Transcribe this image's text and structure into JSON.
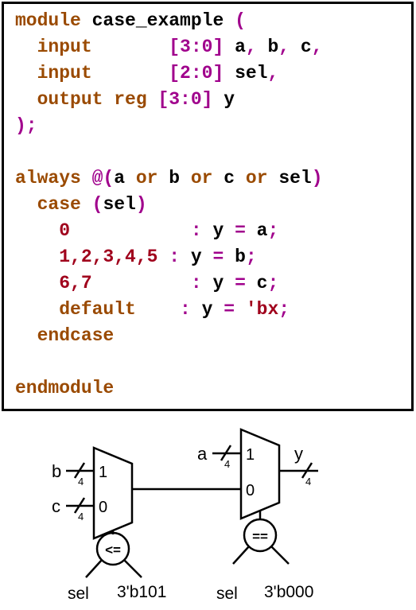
{
  "code": {
    "lines": [
      [
        {
          "t": "module ",
          "c": "kw"
        },
        {
          "t": "case_example ",
          "c": "tx"
        },
        {
          "t": "(",
          "c": "pu"
        }
      ],
      [
        {
          "t": "  input       ",
          "c": "kw"
        },
        {
          "t": "[3:0] ",
          "c": "pu"
        },
        {
          "t": "a",
          "c": "tx"
        },
        {
          "t": ", ",
          "c": "pu"
        },
        {
          "t": "b",
          "c": "tx"
        },
        {
          "t": ", ",
          "c": "pu"
        },
        {
          "t": "c",
          "c": "tx"
        },
        {
          "t": ",",
          "c": "pu"
        }
      ],
      [
        {
          "t": "  input       ",
          "c": "kw"
        },
        {
          "t": "[2:0] ",
          "c": "pu"
        },
        {
          "t": "sel",
          "c": "tx"
        },
        {
          "t": ",",
          "c": "pu"
        }
      ],
      [
        {
          "t": "  output reg ",
          "c": "kw"
        },
        {
          "t": "[3:0] ",
          "c": "pu"
        },
        {
          "t": "y",
          "c": "tx"
        }
      ],
      [
        {
          "t": ");",
          "c": "pu"
        }
      ],
      [],
      [
        {
          "t": "always ",
          "c": "kw"
        },
        {
          "t": "@(",
          "c": "pu"
        },
        {
          "t": "a ",
          "c": "tx"
        },
        {
          "t": "or ",
          "c": "kw"
        },
        {
          "t": "b ",
          "c": "tx"
        },
        {
          "t": "or ",
          "c": "kw"
        },
        {
          "t": "c ",
          "c": "tx"
        },
        {
          "t": "or ",
          "c": "kw"
        },
        {
          "t": "sel",
          "c": "tx"
        },
        {
          "t": ")",
          "c": "pu"
        }
      ],
      [
        {
          "t": "  case ",
          "c": "kw"
        },
        {
          "t": "(",
          "c": "pu"
        },
        {
          "t": "sel",
          "c": "tx"
        },
        {
          "t": ")",
          "c": "pu"
        }
      ],
      [
        {
          "t": "    0           ",
          "c": "nu"
        },
        {
          "t": ": ",
          "c": "pu"
        },
        {
          "t": "y ",
          "c": "tx"
        },
        {
          "t": "= ",
          "c": "pu"
        },
        {
          "t": "a",
          "c": "tx"
        },
        {
          "t": ";",
          "c": "pu"
        }
      ],
      [
        {
          "t": "    1,2,3,4,5 ",
          "c": "nu"
        },
        {
          "t": ": ",
          "c": "pu"
        },
        {
          "t": "y ",
          "c": "tx"
        },
        {
          "t": "= ",
          "c": "pu"
        },
        {
          "t": "b",
          "c": "tx"
        },
        {
          "t": ";",
          "c": "pu"
        }
      ],
      [
        {
          "t": "    6,7         ",
          "c": "nu"
        },
        {
          "t": ": ",
          "c": "pu"
        },
        {
          "t": "y ",
          "c": "tx"
        },
        {
          "t": "= ",
          "c": "pu"
        },
        {
          "t": "c",
          "c": "tx"
        },
        {
          "t": ";",
          "c": "pu"
        }
      ],
      [
        {
          "t": "    default    ",
          "c": "kw"
        },
        {
          "t": ": ",
          "c": "pu"
        },
        {
          "t": "y ",
          "c": "tx"
        },
        {
          "t": "= ",
          "c": "pu"
        },
        {
          "t": "'bx",
          "c": "nu"
        },
        {
          "t": ";",
          "c": "pu"
        }
      ],
      [
        {
          "t": "  endcase",
          "c": "kw"
        }
      ],
      [],
      [
        {
          "t": "endmodule",
          "c": "kw"
        }
      ]
    ]
  },
  "diagram": {
    "mux_left": {
      "inputs": [
        {
          "name": "b",
          "width": "4",
          "sel_label": "1"
        },
        {
          "name": "c",
          "width": "4",
          "sel_label": "0"
        }
      ],
      "compare_op": "<=",
      "compare_inputs": [
        "sel",
        "3'b101"
      ]
    },
    "mux_right": {
      "top_input": {
        "name": "a",
        "width": "4",
        "sel_label": "1"
      },
      "bottom_sel_label": "0",
      "output": {
        "name": "y",
        "width": "4"
      },
      "compare_op": "==",
      "compare_inputs": [
        "sel",
        "3'b000"
      ]
    }
  }
}
